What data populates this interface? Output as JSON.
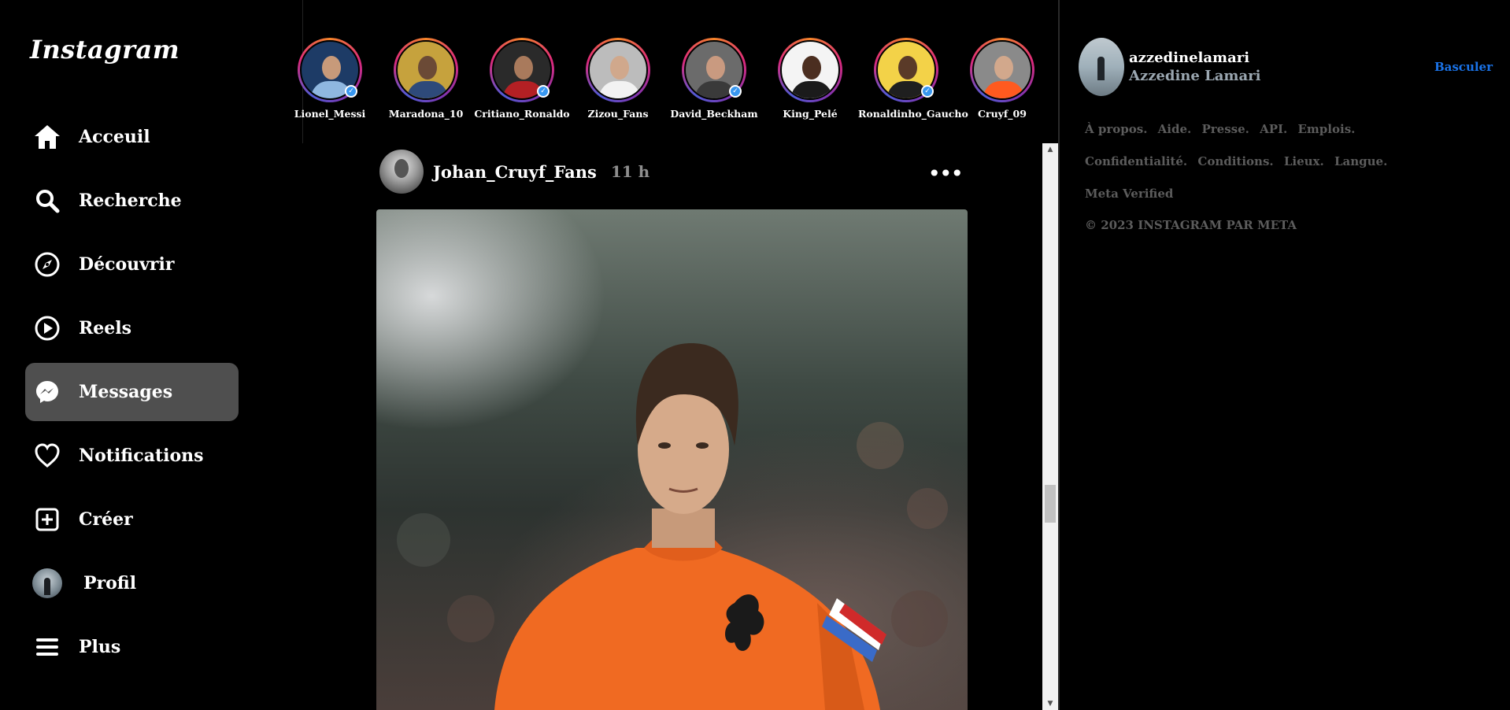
{
  "app": {
    "logo": "Instagram"
  },
  "sidebar": {
    "items": [
      {
        "label": "Acceuil",
        "icon": "home-icon"
      },
      {
        "label": "Recherche",
        "icon": "search-icon"
      },
      {
        "label": "Découvrir",
        "icon": "compass-icon"
      },
      {
        "label": "Reels",
        "icon": "play-icon"
      },
      {
        "label": "Messages",
        "icon": "messenger-icon",
        "active": true
      },
      {
        "label": "Notifications",
        "icon": "heart-icon"
      },
      {
        "label": "Créer",
        "icon": "plus-square-icon"
      },
      {
        "label": "Profil",
        "icon": "avatar"
      },
      {
        "label": "Plus",
        "icon": "menu-icon"
      }
    ]
  },
  "stories": [
    {
      "name": "Lionel_Messi",
      "verified": true,
      "color": "#7aa6d6"
    },
    {
      "name": "Maradona_10",
      "verified": false,
      "color": "#2e4a7a"
    },
    {
      "name": "Critiano_Ronaldo",
      "verified": true,
      "color": "#b32024"
    },
    {
      "name": "Zizou_Fans",
      "verified": false,
      "color": "#e9e9e9"
    },
    {
      "name": "David_Beckham",
      "verified": true,
      "color": "#4a4a4a"
    },
    {
      "name": "King_Pelé",
      "verified": false,
      "color": "#1b1b1b"
    },
    {
      "name": "Ronaldinho_Gaucho",
      "verified": true,
      "color": "#f3d248"
    },
    {
      "name": "Cruyf_09",
      "verified": false,
      "color": "#ff5a1f"
    }
  ],
  "post": {
    "username": "Johan_Cruyf_Fans",
    "time": "11 h",
    "more": "•••"
  },
  "profile": {
    "username": "azzedinelamari",
    "name": "Azzedine Lamari",
    "switch_label": "Basculer"
  },
  "footer": {
    "line1": [
      "À propos.",
      "Aide.",
      "Presse.",
      "API.",
      "Emplois."
    ],
    "line2": [
      "Confidentialité.",
      "Conditions.",
      "Lieux.",
      "Langue."
    ],
    "line3": "Meta Verified",
    "copyright": "© 2023 INSTAGRAM PAR META"
  },
  "colors": {
    "accent": "#1a73e8",
    "active_bg": "#4f4f4f",
    "muted": "#8e8e8e"
  }
}
